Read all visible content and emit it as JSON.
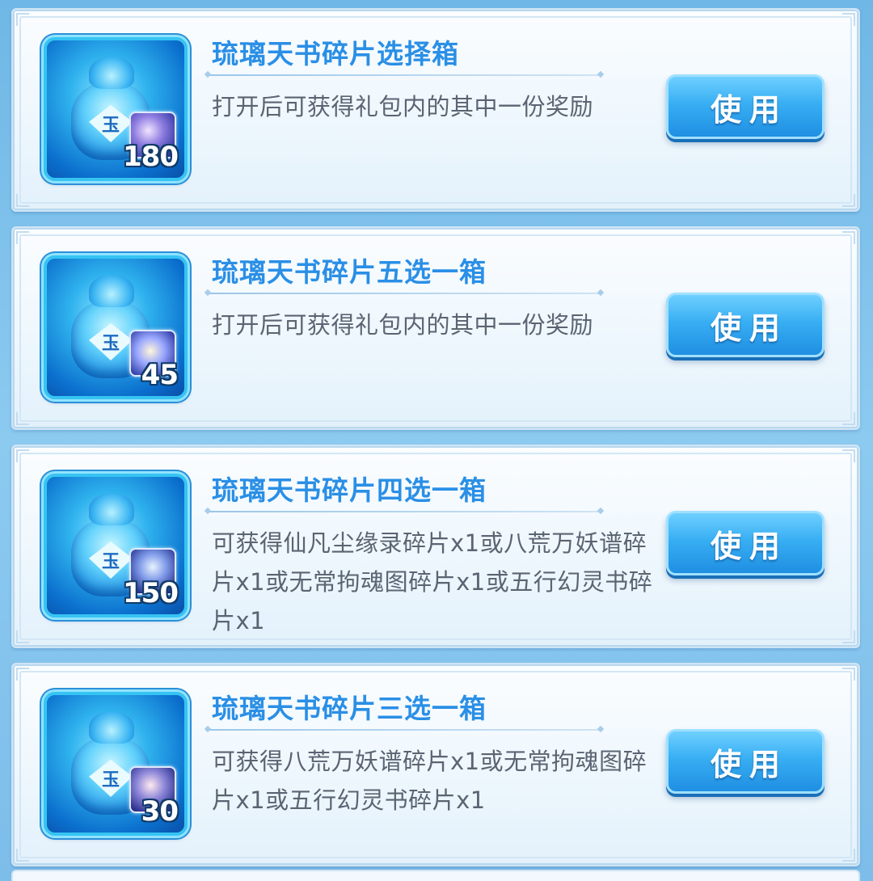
{
  "items": [
    {
      "title": "琉璃天书碎片选择箱",
      "desc": "打开后可获得礼包内的其中一份奖励",
      "count": "180",
      "button": "使用",
      "icon": "jade-bag-icon"
    },
    {
      "title": "琉璃天书碎片五选一箱",
      "desc": "打开后可获得礼包内的其中一份奖励",
      "count": "45",
      "button": "使用",
      "icon": "jade-bag-icon"
    },
    {
      "title": "琉璃天书碎片四选一箱",
      "desc": "可获得仙凡尘缘录碎片x1或八荒万妖谱碎片x1或无常拘魂图碎片x1或五行幻灵书碎片x1",
      "count": "150",
      "button": "使用",
      "icon": "jade-bag-icon"
    },
    {
      "title": "琉璃天书碎片三选一箱",
      "desc": "可获得八荒万妖谱碎片x1或无常拘魂图碎片x1或五行幻灵书碎片x1",
      "count": "30",
      "button": "使用",
      "icon": "jade-bag-icon"
    }
  ],
  "colors": {
    "title": "#2a8fe6",
    "desc": "#5b6472",
    "button": "#38aef3"
  }
}
